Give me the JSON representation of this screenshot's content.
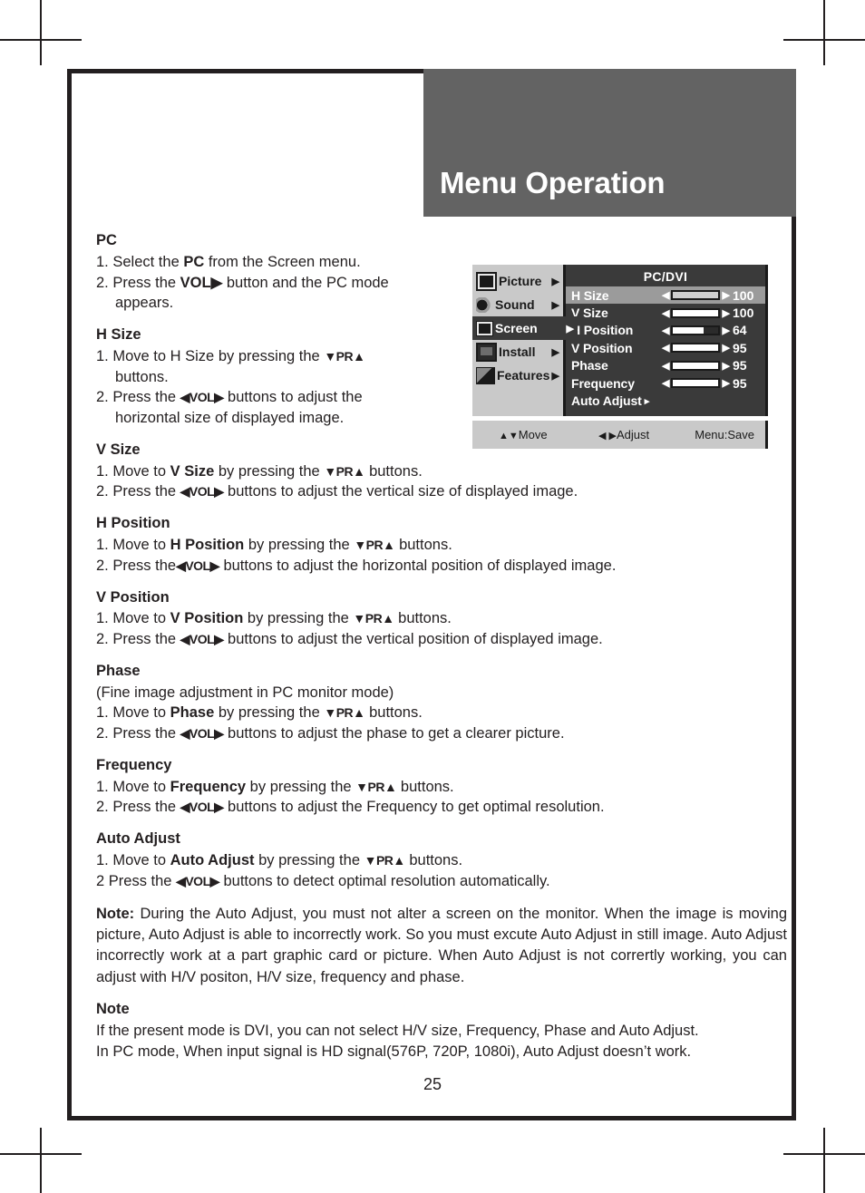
{
  "header": {
    "title": "Menu Operation"
  },
  "page": {
    "number": "25"
  },
  "sections": [
    {
      "heading": "PC",
      "steps": [
        "1. Select the PC from the Screen menu.",
        "2. Press the VOL▶ button and the PC mode appears."
      ]
    },
    {
      "heading": "H Size",
      "steps": [
        "1. Move to H Size by pressing the ▼PR▲ buttons.",
        "2. Press the ◀VOL▶ buttons to adjust the horizontal size of displayed image."
      ]
    },
    {
      "heading": "V Size",
      "steps": [
        "1. Move to V Size by pressing the ▼PR▲ buttons.",
        "2. Press the ◀VOL▶ buttons to adjust the vertical size of displayed image."
      ]
    },
    {
      "heading": "H Position",
      "steps": [
        "1. Move to H Position by pressing the ▼PR▲ buttons.",
        "2. Press the ◀VOL▶ buttons to adjust the horizontal position of displayed image."
      ]
    },
    {
      "heading": "V Position",
      "steps": [
        "1. Move to V Position by pressing the ▼PR▲ buttons.",
        "2. Press the ◀VOL▶ buttons to adjust the vertical position of displayed image."
      ]
    },
    {
      "heading": "Phase",
      "subnote": "(Fine image adjustment in PC monitor mode)",
      "steps": [
        "1. Move to Phase by pressing the ▼PR▲ buttons.",
        "2. Press the ◀VOL▶ buttons to adjust the phase to get a clearer picture."
      ]
    },
    {
      "heading": "Frequency",
      "steps": [
        "1. Move to Frequency by pressing the ▼PR▲ buttons.",
        "2. Press the ◀VOL▶ buttons to adjust the Frequency to get optimal resolution."
      ]
    },
    {
      "heading": "Auto Adjust",
      "steps": [
        "1. Move to Auto Adjust by pressing the ▼PR▲ buttons.",
        "2 Press the ◀VOL▶ buttons to detect optimal resolution automatically."
      ]
    }
  ],
  "text": {
    "pc_step1_a": "1.",
    "pc_step1_b": "Select the ",
    "pc_step1_bold": "PC",
    "pc_step1_c": " from the Screen menu.",
    "pc_step2_a": "2.",
    "pc_step2_b": "Press the ",
    "pc_step2_bold": "VOL▶",
    "pc_step2_c": " button and the PC mode",
    "pc_step2_cont": "appears.",
    "hsize_s1_b": "Move to H Size by pressing the ",
    "hsize_s1_bold": "▼PR▲",
    "hsize_s1_cont": "buttons.",
    "hsize_s2_b": "Press the  ",
    "hsize_s2_bold": "◀VOL▶",
    "hsize_s2_c": " buttons to adjust the",
    "hsize_s2_cont": "horizontal size of displayed image.",
    "vsize_s1_b": "Move to ",
    "vsize_s1_bold1": "V Size",
    "vsize_s1_c": " by pressing the ",
    "vsize_s1_bold2": "▼PR▲",
    "vsize_s1_d": " buttons.",
    "vsize_s2_b": "Press the ",
    "vsize_s2_bold": "◀VOL▶",
    "vsize_s2_c": " buttons to adjust the vertical size of displayed image.",
    "hpos_s1_b": "Move to ",
    "hpos_s1_bold1": "H Position",
    "hpos_s1_c": " by pressing the ",
    "hpos_s1_bold2": "▼PR▲",
    "hpos_s1_d": " buttons.",
    "hpos_s2_b": "Press the",
    "hpos_s2_bold": "◀VOL▶",
    "hpos_s2_c": " buttons to adjust the horizontal position of displayed image.",
    "vpos_s1_b": "Move to ",
    "vpos_s1_bold1": "V Position",
    "vpos_s1_c": " by pressing the ",
    "vpos_s1_bold2": "▼PR▲",
    "vpos_s1_d": " buttons.",
    "vpos_s2_b": "Press the ",
    "vpos_s2_bold": "◀VOL▶",
    "vpos_s2_c": " buttons to adjust the vertical position of displayed image.",
    "phase_sub": "(Fine image adjustment in PC monitor mode)",
    "phase_s1_b": "Move to ",
    "phase_s1_bold1": "Phase",
    "phase_s1_c": " by pressing the ",
    "phase_s1_bold2": "▼PR▲",
    "phase_s1_d": " buttons.",
    "phase_s2_b": "Press the ",
    "phase_s2_bold": "◀VOL▶",
    "phase_s2_c": " buttons to adjust the phase to get a clearer picture.",
    "freq_s1_b": "Move to ",
    "freq_s1_bold1": "Frequency",
    "freq_s1_c": " by pressing the ",
    "freq_s1_bold2": "▼PR▲",
    "freq_s1_d": " buttons.",
    "freq_s2_b": "Press the ",
    "freq_s2_bold": "◀VOL▶",
    "freq_s2_c": " buttons to adjust the Frequency to get optimal resolution.",
    "auto_s1_b": "Move to ",
    "auto_s1_bold1": "Auto Adjust",
    "auto_s1_c": " by pressing the ",
    "auto_s1_bold2": "▼PR▲",
    "auto_s1_d": " buttons.",
    "auto_s2_a": "2",
    "auto_s2_b": "Press the ",
    "auto_s2_bold": "◀VOL▶",
    "auto_s2_c": " buttons to detect optimal resolution automatically.",
    "note1_label": "Note:",
    "note1_body": " During the Auto Adjust, you must not alter a screen on the monitor. When the image is moving picture, Auto Adjust is able to incorrectly work. So you must excute Auto Adjust in still image. Auto Adjust incorrectly work at a part graphic card or picture. When Auto Adjust is not corrertly working, you can adjust with H/V positon, H/V size, frequency and phase.",
    "note2_label": "Note",
    "note2_line1": "If the present mode is DVI, you can not select H/V size, Frequency, Phase and Auto Adjust.",
    "note2_line2": "In PC mode, When input signal is HD signal(576P, 720P, 1080i), Auto Adjust doesn’t work."
  },
  "osd": {
    "title": "PC/DVI",
    "sidebar": [
      {
        "label": "Picture",
        "arrow": "▶",
        "icon": "picture-icon",
        "active": false
      },
      {
        "label": "Sound",
        "arrow": "▶",
        "icon": "sound-icon",
        "active": false
      },
      {
        "label": "Screen",
        "arrow": "▶",
        "icon": "screen-icon",
        "active": true
      },
      {
        "label": "Install",
        "arrow": "▶",
        "icon": "install-icon",
        "active": false
      },
      {
        "label": "Features",
        "arrow": "▶",
        "icon": "features-icon",
        "active": false
      }
    ],
    "rows": [
      {
        "label": "H Size",
        "value": "100",
        "fill": 100,
        "highlight": true,
        "hasBar": true
      },
      {
        "label": "V Size",
        "value": "100",
        "fill": 100,
        "highlight": false,
        "hasBar": true
      },
      {
        "label": "H Position",
        "value": "64",
        "fill": 68,
        "highlight": false,
        "hasBar": true
      },
      {
        "label": "V Position",
        "value": "95",
        "fill": 100,
        "highlight": false,
        "hasBar": true
      },
      {
        "label": "Phase",
        "value": "95",
        "fill": 100,
        "highlight": false,
        "hasBar": true
      },
      {
        "label": "Frequency",
        "value": "95",
        "fill": 100,
        "highlight": false,
        "hasBar": true
      },
      {
        "label": "Auto Adjust",
        "value": "",
        "fill": 0,
        "highlight": false,
        "hasBar": false,
        "arrow": "▸"
      }
    ],
    "footer": {
      "move_glyph": "▲▼",
      "move_label": "Move",
      "adjust_glyph": "◀ ▶",
      "adjust_label": "Adjust",
      "save_label": "Menu:Save"
    }
  },
  "colors": {
    "banner_gray": "#636363",
    "frame_black": "#231f20",
    "osd_panel_dark": "#3a3a3a",
    "osd_sidebar_gray": "#c9c9c9",
    "osd_highlight_gray": "#9b9b9b"
  }
}
